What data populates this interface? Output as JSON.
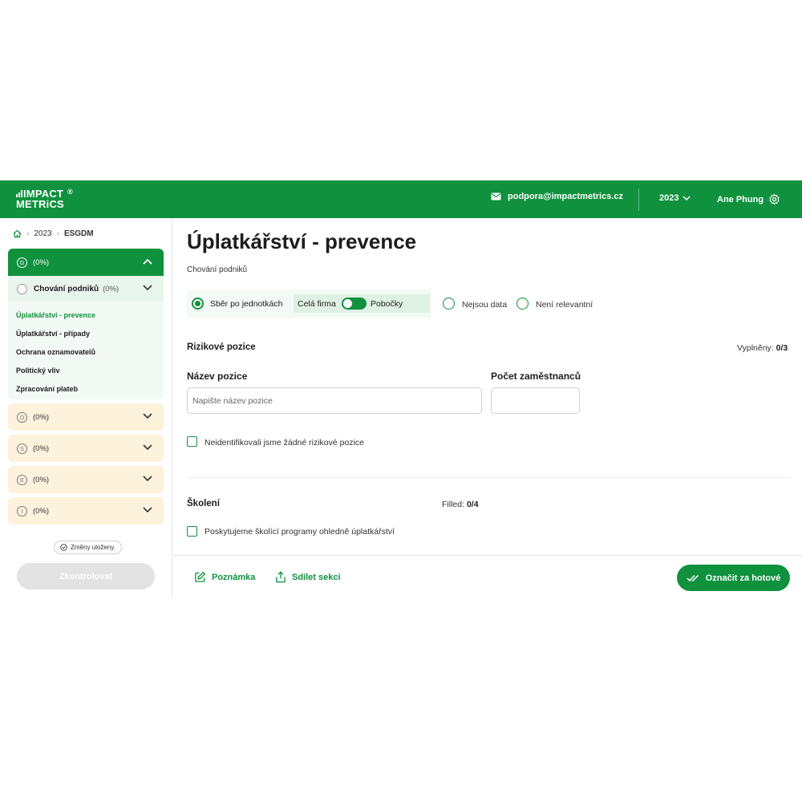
{
  "header": {
    "logo_line1": "IMPACT",
    "logo_line2": "METRiCS",
    "logo_reg": "®",
    "email": "podpora@impactmetrics.cz",
    "year": "2023",
    "user": "Ane Phung",
    "brand_color": "#10913e"
  },
  "breadcrumb": {
    "year": "2023",
    "section": "ESGDM"
  },
  "sidebar": {
    "group_g": {
      "letter": "G",
      "pct": "(0%)"
    },
    "subgroup": {
      "title": "Chování podniků",
      "pct": "(0%)"
    },
    "items": [
      {
        "label": "Úplatkářství - prevence",
        "active": true
      },
      {
        "label": "Úplatkářství - případy"
      },
      {
        "label": "Ochrana oznamovatelů"
      },
      {
        "label": "Politický vliv"
      },
      {
        "label": "Zpracování plateb"
      }
    ],
    "categories": [
      {
        "letter": "O",
        "pct": "(0%)"
      },
      {
        "letter": "S",
        "pct": "(0%)"
      },
      {
        "letter": "E",
        "pct": "(0%)"
      },
      {
        "letter": "I",
        "pct": "(0%)"
      }
    ],
    "saved": "Změny uloženy.",
    "check_button": "Zkontrolovat"
  },
  "main": {
    "title": "Úplatkářství - prevence",
    "subtitle": "Chování podniků",
    "options": {
      "collect": "Sběr po jednotkách",
      "whole_company": "Celá firma",
      "branches": "Pobočky",
      "no_data": "Nejsou data",
      "not_relevant": "Není relevantní"
    },
    "risk": {
      "title": "Rizikové pozice",
      "filled_label": "Vyplněny:",
      "filled_value": "0/3",
      "position_label": "Název pozice",
      "position_placeholder": "Napište název pozice",
      "employees_label": "Počet zaměstnanců",
      "checkbox": "Neidentifikovali jsme žádné rizikové pozice"
    },
    "training": {
      "title": "Školení",
      "filled_label": "Filled:",
      "filled_value": "0/4",
      "checkbox": "Poskytujeme školící programy ohledně úplatkářství"
    }
  },
  "footer": {
    "note": "Poznámka",
    "share": "Sdílet sekci",
    "done": "Označit za hotové"
  }
}
